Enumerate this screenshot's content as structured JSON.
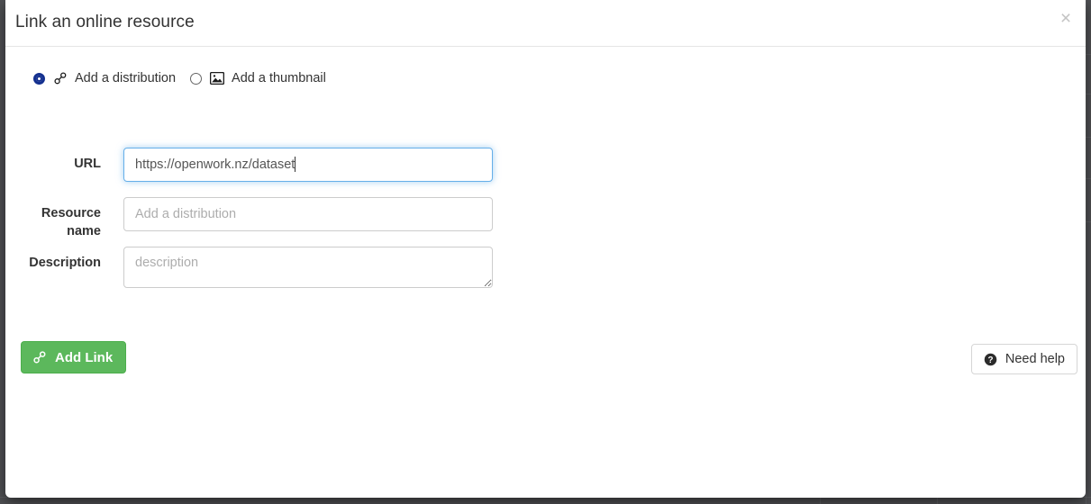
{
  "modal": {
    "title": "Link an online resource",
    "close_label": "×"
  },
  "resource_type": {
    "options": [
      {
        "label": "Add a distribution",
        "icon": "link-icon",
        "selected": true
      },
      {
        "label": "Add a thumbnail",
        "icon": "image-icon",
        "selected": false
      }
    ]
  },
  "form": {
    "url": {
      "label": "URL",
      "value": "https://openwork.nz/dataset",
      "placeholder": "",
      "focused": true
    },
    "resource_name": {
      "label": "Resource name",
      "value": "",
      "placeholder": "Add a distribution",
      "focused": false
    },
    "description": {
      "label": "Description",
      "value": "",
      "placeholder": "description",
      "focused": false
    }
  },
  "actions": {
    "add_link": {
      "label": "Add Link",
      "icon": "link-icon"
    },
    "need_help": {
      "label": "Need help",
      "icon": "question-circle-icon"
    }
  },
  "colors": {
    "primary_green": "#5cb85c",
    "focus_blue": "#66afe9",
    "radio_blue": "#14308f",
    "overlay": "#4f5053"
  }
}
